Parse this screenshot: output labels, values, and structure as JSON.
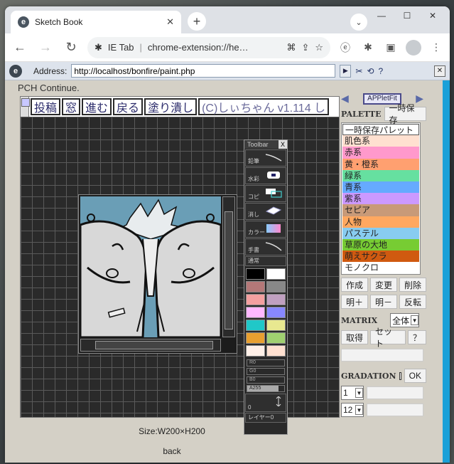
{
  "browser": {
    "tab_title": "Sketch Book",
    "tab_favicon": "e",
    "new_tab": "+",
    "omnibox_ext": "IE Tab",
    "omnibox_url": "chrome-extension://he…",
    "ietab_logo": "e",
    "address_label": "Address:",
    "address_value": "http://localhost/bonfire/paint.php"
  },
  "page": {
    "pch_continue": "PCH Continue.",
    "size_text": "Size:W200×H200",
    "back_link": "back"
  },
  "pch": {
    "menu": [
      "投稿",
      "窓",
      "進む",
      "戻る",
      "塗り潰し",
      "(C)しぃちゃん v1.114 し"
    ],
    "toolbar_title": "Toolbar",
    "toolbar_close": "X",
    "tools": [
      "鉛筆",
      "水彩",
      "コピ",
      "消し",
      "カラー",
      "手書",
      "通常"
    ],
    "swatches": [
      "#000000",
      "#ffffff",
      "#b47878",
      "#888888",
      "#f4a0a0",
      "#c0a0c0",
      "#ffb8ff",
      "#8888ff",
      "#20c8c8",
      "#e8e890",
      "#e8a030",
      "#a0d070",
      "#fff0e8",
      "#ffe0d0"
    ],
    "sliders": [
      "R0",
      "G0",
      "B0",
      "A255"
    ],
    "size_value": "0",
    "layer_label": "レイヤー0"
  },
  "right_panel": {
    "appletfit_label": "APPletFit",
    "palette_title": "PALETTE",
    "temp_save": "一時保存",
    "palettes": [
      {
        "label": "一時保存パレット",
        "color": "#ffffff"
      },
      {
        "label": "肌色系",
        "color": "#ffe0d0"
      },
      {
        "label": "赤系",
        "color": "#ff99cc"
      },
      {
        "label": "黄・橙系",
        "color": "#ffa070"
      },
      {
        "label": "緑系",
        "color": "#66e0a0"
      },
      {
        "label": "青系",
        "color": "#66aaff"
      },
      {
        "label": "紫系",
        "color": "#cc99ff"
      },
      {
        "label": "セピア",
        "color": "#c89a78"
      },
      {
        "label": "人物",
        "color": "#ffa860"
      },
      {
        "label": "パステル",
        "color": "#88ccf0"
      },
      {
        "label": "草原の大地",
        "color": "#77cc33"
      },
      {
        "label": "萌えサクラ",
        "color": "#d05a10"
      },
      {
        "label": "モノクロ",
        "color": "#ffffff"
      }
    ],
    "btn_create": "作成",
    "btn_change": "変更",
    "btn_delete": "削除",
    "btn_bright_plus": "明＋",
    "btn_bright_minus": "明－",
    "btn_invert": "反転",
    "matrix_title": "MATRIX",
    "matrix_select": "全体",
    "btn_get": "取得",
    "btn_set": "セット",
    "btn_help": "？",
    "gradation_title": "GRADATION",
    "btn_ok": "OK",
    "grad_select_1": "1",
    "grad_select_2": "12"
  }
}
